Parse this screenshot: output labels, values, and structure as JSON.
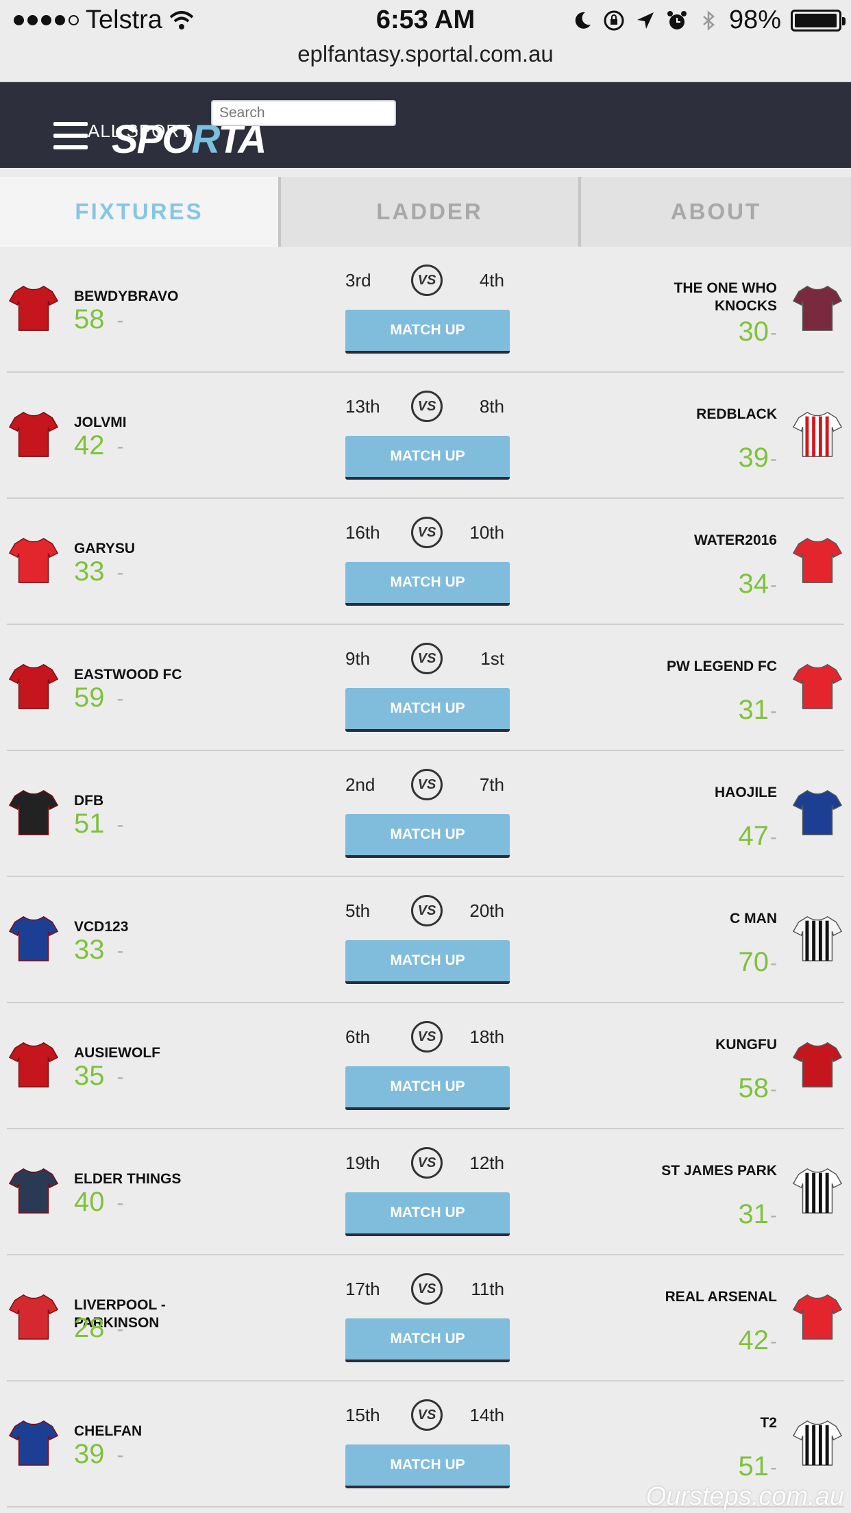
{
  "status": {
    "carrier": "Telstra",
    "time": "6:53 AM",
    "battery": "98%",
    "url": "eplfantasy.sportal.com.au"
  },
  "header": {
    "menu_label": "ALL SPORT",
    "logo_left": "SPO",
    "logo_mid": "R",
    "logo_right": "TA",
    "search_placeholder": "Search"
  },
  "tabs": [
    "FIXTURES",
    "LADDER",
    "ABOUT"
  ],
  "fixtures": [
    {
      "home": "BEWDYBRAVO",
      "home_score": "58",
      "home_rank": "3rd",
      "away_rank": "4th",
      "away": "THE ONE WHO KNOCKS",
      "away_score": "30"
    },
    {
      "home": "JOLVMI",
      "home_score": "42",
      "home_rank": "13th",
      "away_rank": "8th",
      "away": "REDBLACK",
      "away_score": "39"
    },
    {
      "home": "GARYSU",
      "home_score": "33",
      "home_rank": "16th",
      "away_rank": "10th",
      "away": "WATER2016",
      "away_score": "34"
    },
    {
      "home": "EASTWOOD FC",
      "home_score": "59",
      "home_rank": "9th",
      "away_rank": "1st",
      "away": "PW LEGEND FC",
      "away_score": "31"
    },
    {
      "home": "DFB",
      "home_score": "51",
      "home_rank": "2nd",
      "away_rank": "7th",
      "away": "HAOJILE",
      "away_score": "47"
    },
    {
      "home": "VCD123",
      "home_score": "33",
      "home_rank": "5th",
      "away_rank": "20th",
      "away": "C MAN",
      "away_score": "70"
    },
    {
      "home": "AUSIEWOLF",
      "home_score": "35",
      "home_rank": "6th",
      "away_rank": "18th",
      "away": "KUNGFU",
      "away_score": "58"
    },
    {
      "home": "ELDER THINGS",
      "home_score": "40",
      "home_rank": "19th",
      "away_rank": "12th",
      "away": "ST JAMES PARK",
      "away_score": "31"
    },
    {
      "home": "LIVERPOOL - PARKINSON",
      "home_score": "28",
      "home_rank": "17th",
      "away_rank": "11th",
      "away": "REAL ARSENAL",
      "away_score": "42"
    },
    {
      "home": "CHELFAN",
      "home_score": "39",
      "home_rank": "15th",
      "away_rank": "14th",
      "away": "T2",
      "away_score": "51"
    }
  ],
  "labels": {
    "vs": "VS",
    "match_up": "MATCH UP",
    "dash": "-"
  },
  "watermark": "Oursteps.com.au",
  "colors": {
    "header_bg": "#2d2f3d",
    "accent": "#80bcdc",
    "score_green": "#7fc23a"
  }
}
